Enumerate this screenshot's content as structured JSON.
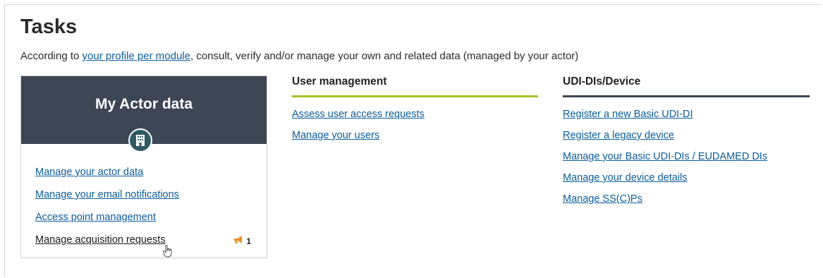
{
  "page": {
    "title": "Tasks",
    "intro_prefix": "According to ",
    "intro_link": "your profile per module",
    "intro_suffix": ", consult, verify and/or manage your own and related data (managed by your actor)"
  },
  "actor_card": {
    "title": "My Actor data",
    "icon": "building-icon",
    "links": [
      "Manage your actor data",
      "Manage your email notifications",
      "Access point management",
      "Manage acquisition requests"
    ],
    "badge_count": "1",
    "badge_icon": "megaphone-icon"
  },
  "user_management": {
    "title": "User management",
    "accent": "#a3c527",
    "links": [
      "Assess user access requests",
      "Manage your users"
    ]
  },
  "udi_device": {
    "title": "UDI-DIs/Device",
    "accent": "#3c4655",
    "links": [
      "Register a new Basic UDI-DI",
      "Register a legacy device",
      "Manage your Basic UDI-DIs / EUDAMED DIs",
      "Manage your device details",
      "Manage SS(C)Ps"
    ]
  },
  "colors": {
    "link": "#0b5c9a",
    "card_header": "#3c4655",
    "icon_circle": "#2f5964",
    "badge_icon": "#e8922a"
  }
}
